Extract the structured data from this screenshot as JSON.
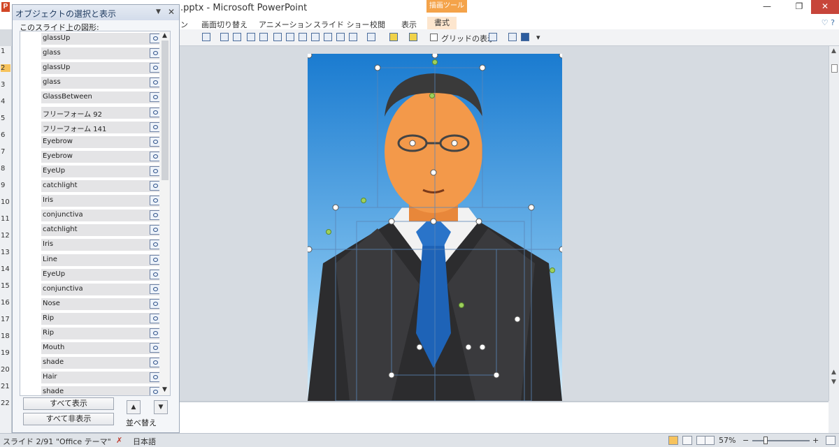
{
  "window": {
    "app_icon": "P",
    "title": ".pptx - Microsoft PowerPoint",
    "context_tab_header": "描画ツール",
    "minimize": "—",
    "restore": "❐",
    "close": "✕"
  },
  "ribbon": {
    "tabs": [
      {
        "label": "ン"
      },
      {
        "label": "画面切り替え"
      },
      {
        "label": "アニメーション"
      },
      {
        "label": "スライド ショー"
      },
      {
        "label": "校閲"
      },
      {
        "label": "表示"
      },
      {
        "label": "書式"
      }
    ],
    "help": "♡ ?"
  },
  "toolbar": {
    "gridlines_label": "グリッドの表示"
  },
  "selection_pane": {
    "title": "オブジェクトの選択と表示",
    "dropdown_icon": "▼",
    "close_icon": "✕",
    "subtitle": "このスライド上の図形:",
    "items": [
      {
        "label": "glassUp"
      },
      {
        "label": "glass"
      },
      {
        "label": "glassUp"
      },
      {
        "label": "glass"
      },
      {
        "label": "GlassBetween"
      },
      {
        "label": "フリーフォーム 92"
      },
      {
        "label": "フリーフォーム 141"
      },
      {
        "label": "Eyebrow"
      },
      {
        "label": "Eyebrow"
      },
      {
        "label": "EyeUp"
      },
      {
        "label": "catchlight"
      },
      {
        "label": "Iris"
      },
      {
        "label": "conjunctiva"
      },
      {
        "label": "catchlight"
      },
      {
        "label": "Iris"
      },
      {
        "label": "Line"
      },
      {
        "label": "EyeUp"
      },
      {
        "label": "conjunctiva"
      },
      {
        "label": "Nose"
      },
      {
        "label": "Rip"
      },
      {
        "label": "Rip"
      },
      {
        "label": "Mouth"
      },
      {
        "label": "shade"
      },
      {
        "label": "Hair"
      },
      {
        "label": "shade"
      }
    ],
    "show_all": "すべて表示",
    "hide_all": "すべて非表示",
    "reorder_label": "並べ替え",
    "up_arrow": "▲",
    "down_arrow": "▼"
  },
  "thumbnails": {
    "numbers": [
      "1",
      "2",
      "3",
      "4",
      "5",
      "6",
      "7",
      "8",
      "9",
      "10",
      "11",
      "12",
      "13",
      "14",
      "15",
      "16",
      "17",
      "18",
      "19",
      "20",
      "21",
      "22"
    ],
    "active_index": 1
  },
  "status_bar": {
    "slide_info": "スライド 2/91",
    "theme": "\"Office テーマ\"",
    "language": "日本語",
    "zoom": "57%",
    "zoom_minus": "−",
    "zoom_plus": "+"
  }
}
